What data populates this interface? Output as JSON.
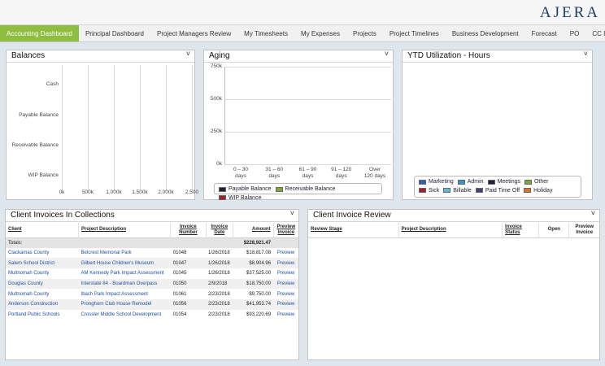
{
  "brand": {
    "logo": "AJERA"
  },
  "nav": {
    "tabs": [
      {
        "label": "Accounting Dashboard",
        "active": true
      },
      {
        "label": "Principal Dashboard"
      },
      {
        "label": "Project Managers Review"
      },
      {
        "label": "My Timesheets"
      },
      {
        "label": "My Expenses"
      },
      {
        "label": "Projects"
      },
      {
        "label": "Project Timelines"
      },
      {
        "label": "Business Development"
      },
      {
        "label": "Forecast"
      },
      {
        "label": "PO"
      },
      {
        "label": "CC Import"
      }
    ]
  },
  "balances": {
    "title": "Balances",
    "collapse": "˅",
    "categories": [
      "Cash",
      "Payable Balance",
      "Receivable Balance",
      "WIP Balance"
    ],
    "ticks": [
      "0k",
      "500k",
      "1,000k",
      "1,500k",
      "2,000k",
      "2,500"
    ]
  },
  "aging": {
    "title": "Aging",
    "collapse": "˅",
    "y_ticks": [
      "750k",
      "500k",
      "250k",
      "0k"
    ],
    "x_ticks": [
      [
        "0 – 30",
        "days"
      ],
      [
        "31 – 60",
        "days"
      ],
      [
        "61 – 90",
        "days"
      ],
      [
        "91 – 120",
        "days"
      ],
      [
        "Over",
        "120 days"
      ]
    ],
    "legend": [
      {
        "label": "Payable Balance",
        "color": "#1b2335"
      },
      {
        "label": "Receivable Balance",
        "color": "#7fa83a"
      },
      {
        "label": "WIP Balance",
        "color": "#a51d2d"
      }
    ]
  },
  "utilization": {
    "title": "YTD Utilization - Hours",
    "collapse": "˅",
    "legend": [
      {
        "label": "Marketing",
        "color": "#2d62b8"
      },
      {
        "label": "Admin",
        "color": "#2e96c9"
      },
      {
        "label": "Meetings",
        "color": "#1b2335"
      },
      {
        "label": "Other",
        "color": "#7fa83a"
      },
      {
        "label": "Sick",
        "color": "#a51d2d"
      },
      {
        "label": "Billable",
        "color": "#63b7d6"
      },
      {
        "label": "Paid Time Off",
        "color": "#4b3f78"
      },
      {
        "label": "Holiday",
        "color": "#e0702a"
      }
    ]
  },
  "collections": {
    "title": "Client Invoices In Collections",
    "collapse": "˅",
    "columns": {
      "client": "Client",
      "project": "Project Description",
      "invoice_number": [
        "Invoice",
        "Number"
      ],
      "invoice_date": [
        "Invoice",
        "Date"
      ],
      "amount": "Amount",
      "preview": [
        "Preview",
        "Invoice"
      ]
    },
    "totals_label": "Totals:",
    "totals_amount": "$228,921.47",
    "rows": [
      {
        "client": "Clackamas County",
        "project": "Belcrest Memorial Park",
        "number": "01048",
        "date": "1/26/2018",
        "amount": "$18,817.08",
        "preview": "Preview"
      },
      {
        "client": "Salem School District",
        "project": "Gilbert House Children's Museum",
        "number": "01047",
        "date": "1/26/2018",
        "amount": "$8,904.96",
        "preview": "Preview"
      },
      {
        "client": "Multnomah County",
        "project": "AM Kennedy Park Impact Assessment",
        "number": "01045",
        "date": "1/26/2018",
        "amount": "$37,525.00",
        "preview": "Preview"
      },
      {
        "client": "Douglas County",
        "project": "Interstate 84 - Boardman Overpass",
        "number": "01050",
        "date": "2/9/2018",
        "amount": "$18,750.00",
        "preview": "Preview"
      },
      {
        "client": "Multnomah County",
        "project": "Ibach Park Impact Assessment",
        "number": "01061",
        "date": "2/23/2018",
        "amount": "$9,750.00",
        "preview": "Preview"
      },
      {
        "client": "Anderson Construction",
        "project": "Pronghorn Club House Remodel",
        "number": "01056",
        "date": "2/23/2018",
        "amount": "$41,953.74",
        "preview": "Preview"
      },
      {
        "client": "Portland Public Schools",
        "project": "Crossler Middle School Development",
        "number": "01054",
        "date": "2/23/2018",
        "amount": "$93,220.69",
        "preview": "Preview"
      }
    ]
  },
  "review": {
    "title": "Client Invoice Review",
    "collapse": "˅",
    "columns": {
      "stage": "Review Stage",
      "project": "Project Description",
      "status": [
        "Invoice",
        "Status"
      ],
      "open": "Open",
      "preview": [
        "Preview",
        "Invoice"
      ]
    }
  }
}
